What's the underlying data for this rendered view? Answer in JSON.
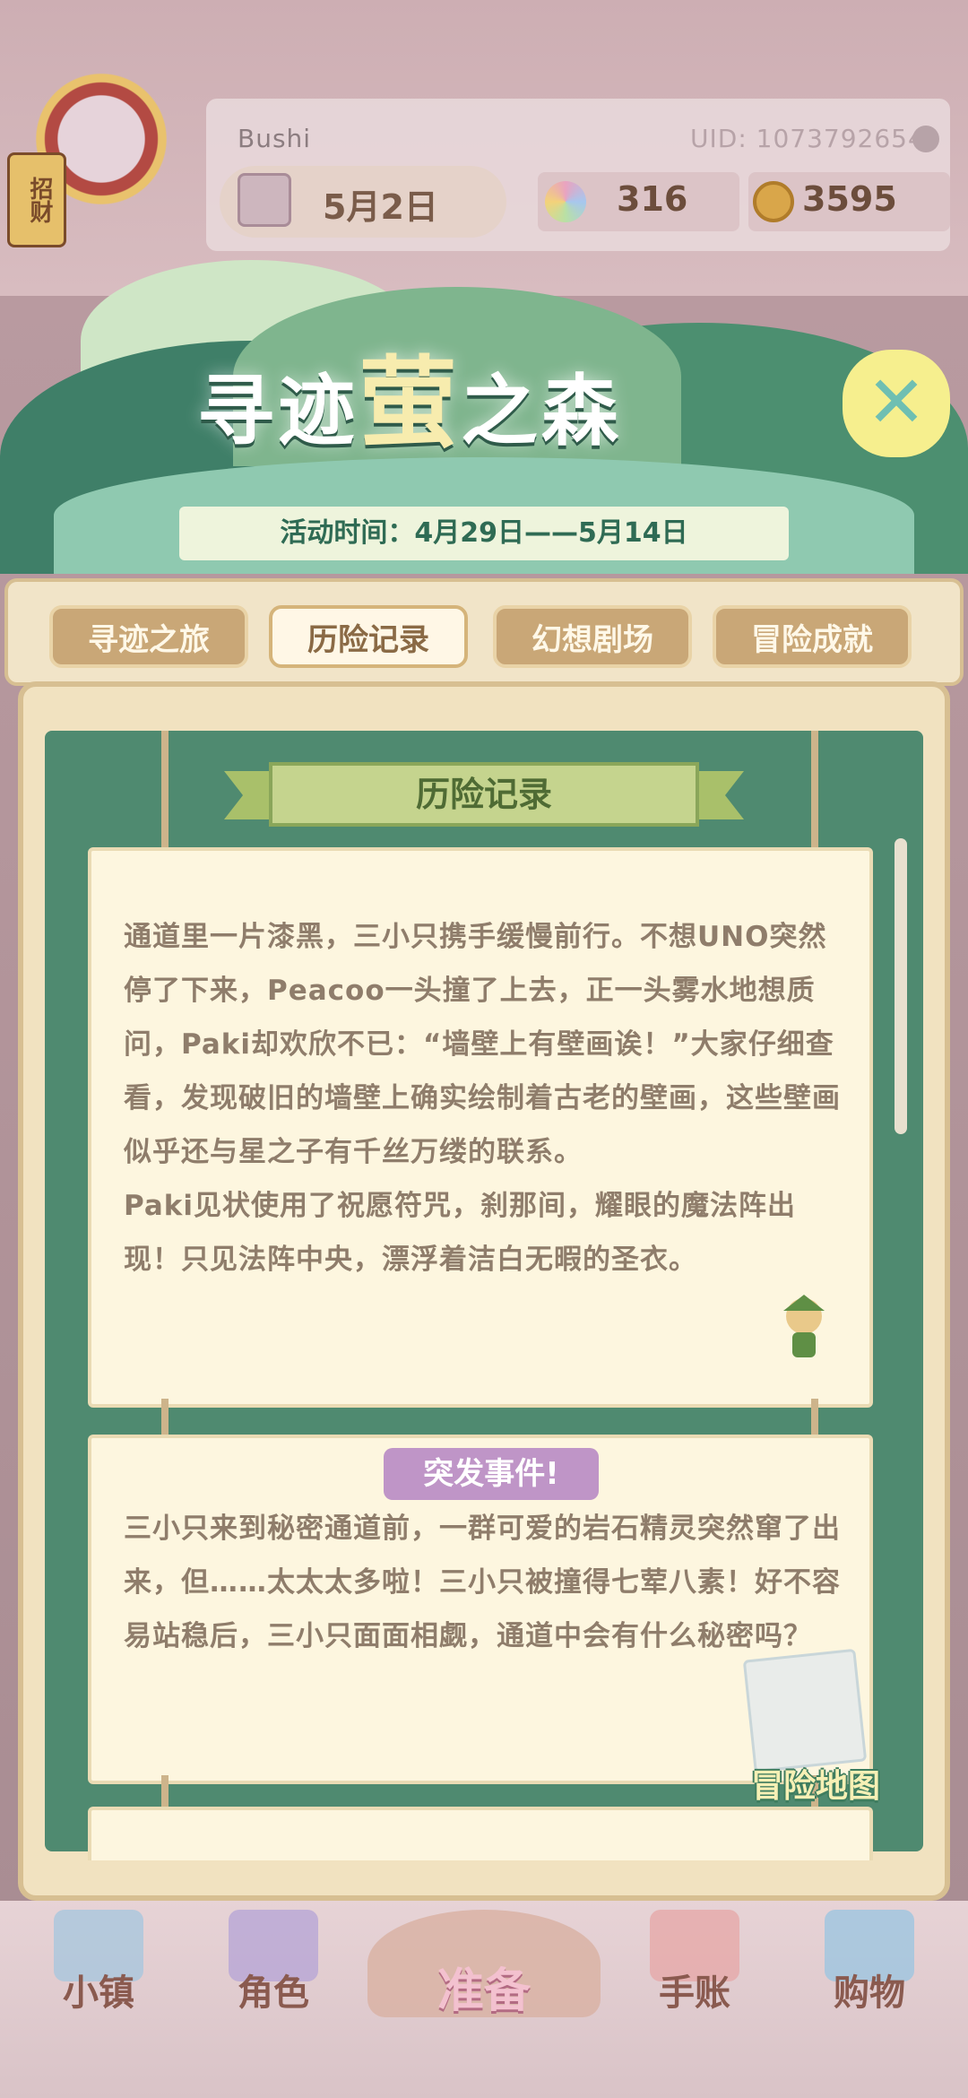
{
  "profile": {
    "username": "Bushi",
    "uid": "UID: 1073792654",
    "date": "5月2日",
    "gems": "316",
    "coins": "3595",
    "avatar_tag": "招财"
  },
  "event": {
    "title_part1": "寻迹",
    "title_part2": "萤",
    "title_part3": "之森",
    "date_range": "活动时间：4月29日——5月14日",
    "close_symbol": "✕"
  },
  "tabs": [
    {
      "label": "寻迹之旅",
      "active": false
    },
    {
      "label": "历险记录",
      "active": true
    },
    {
      "label": "幻想剧场",
      "active": false
    },
    {
      "label": "冒险成就",
      "active": false
    }
  ],
  "record": {
    "header": "历险记录",
    "paragraphs": [
      "通道里一片漆黑，三小只携手缓慢前行。不想UNO突然停了下来，Peacoo一头撞了上去，正一头雾水地想质问，Paki却欢欣不已：“墙壁上有壁画诶！”大家仔细查看，发现破旧的墙壁上确实绘制着古老的壁画，这些壁画似乎还与星之子有千丝万缕的联系。",
      "Paki见状使用了祝愿符咒，刹那间，耀眼的魔法阵出现！只见法阵中央，漂浮着洁白无暇的圣衣。"
    ],
    "event_badge": "突发事件!",
    "event_text": "三小只来到秘密通道前，一群可爱的岩石精灵突然窜了出来，但……太太太多啦！三小只被撞得七荤八素！好不容易站稳后，三小只面面相觑，通道中会有什么秘密吗？",
    "map_label": "冒险地图"
  },
  "nav": {
    "town": "小镇",
    "character": "角色",
    "prepare": "准备",
    "journal": "手账",
    "shop": "购物"
  },
  "colors": {
    "board_green": "#4f8a70",
    "paper": "#fdf6df",
    "tab_inactive": "#c9a777",
    "tab_active": "#fff7e6",
    "event_badge": "#bf95c7"
  }
}
